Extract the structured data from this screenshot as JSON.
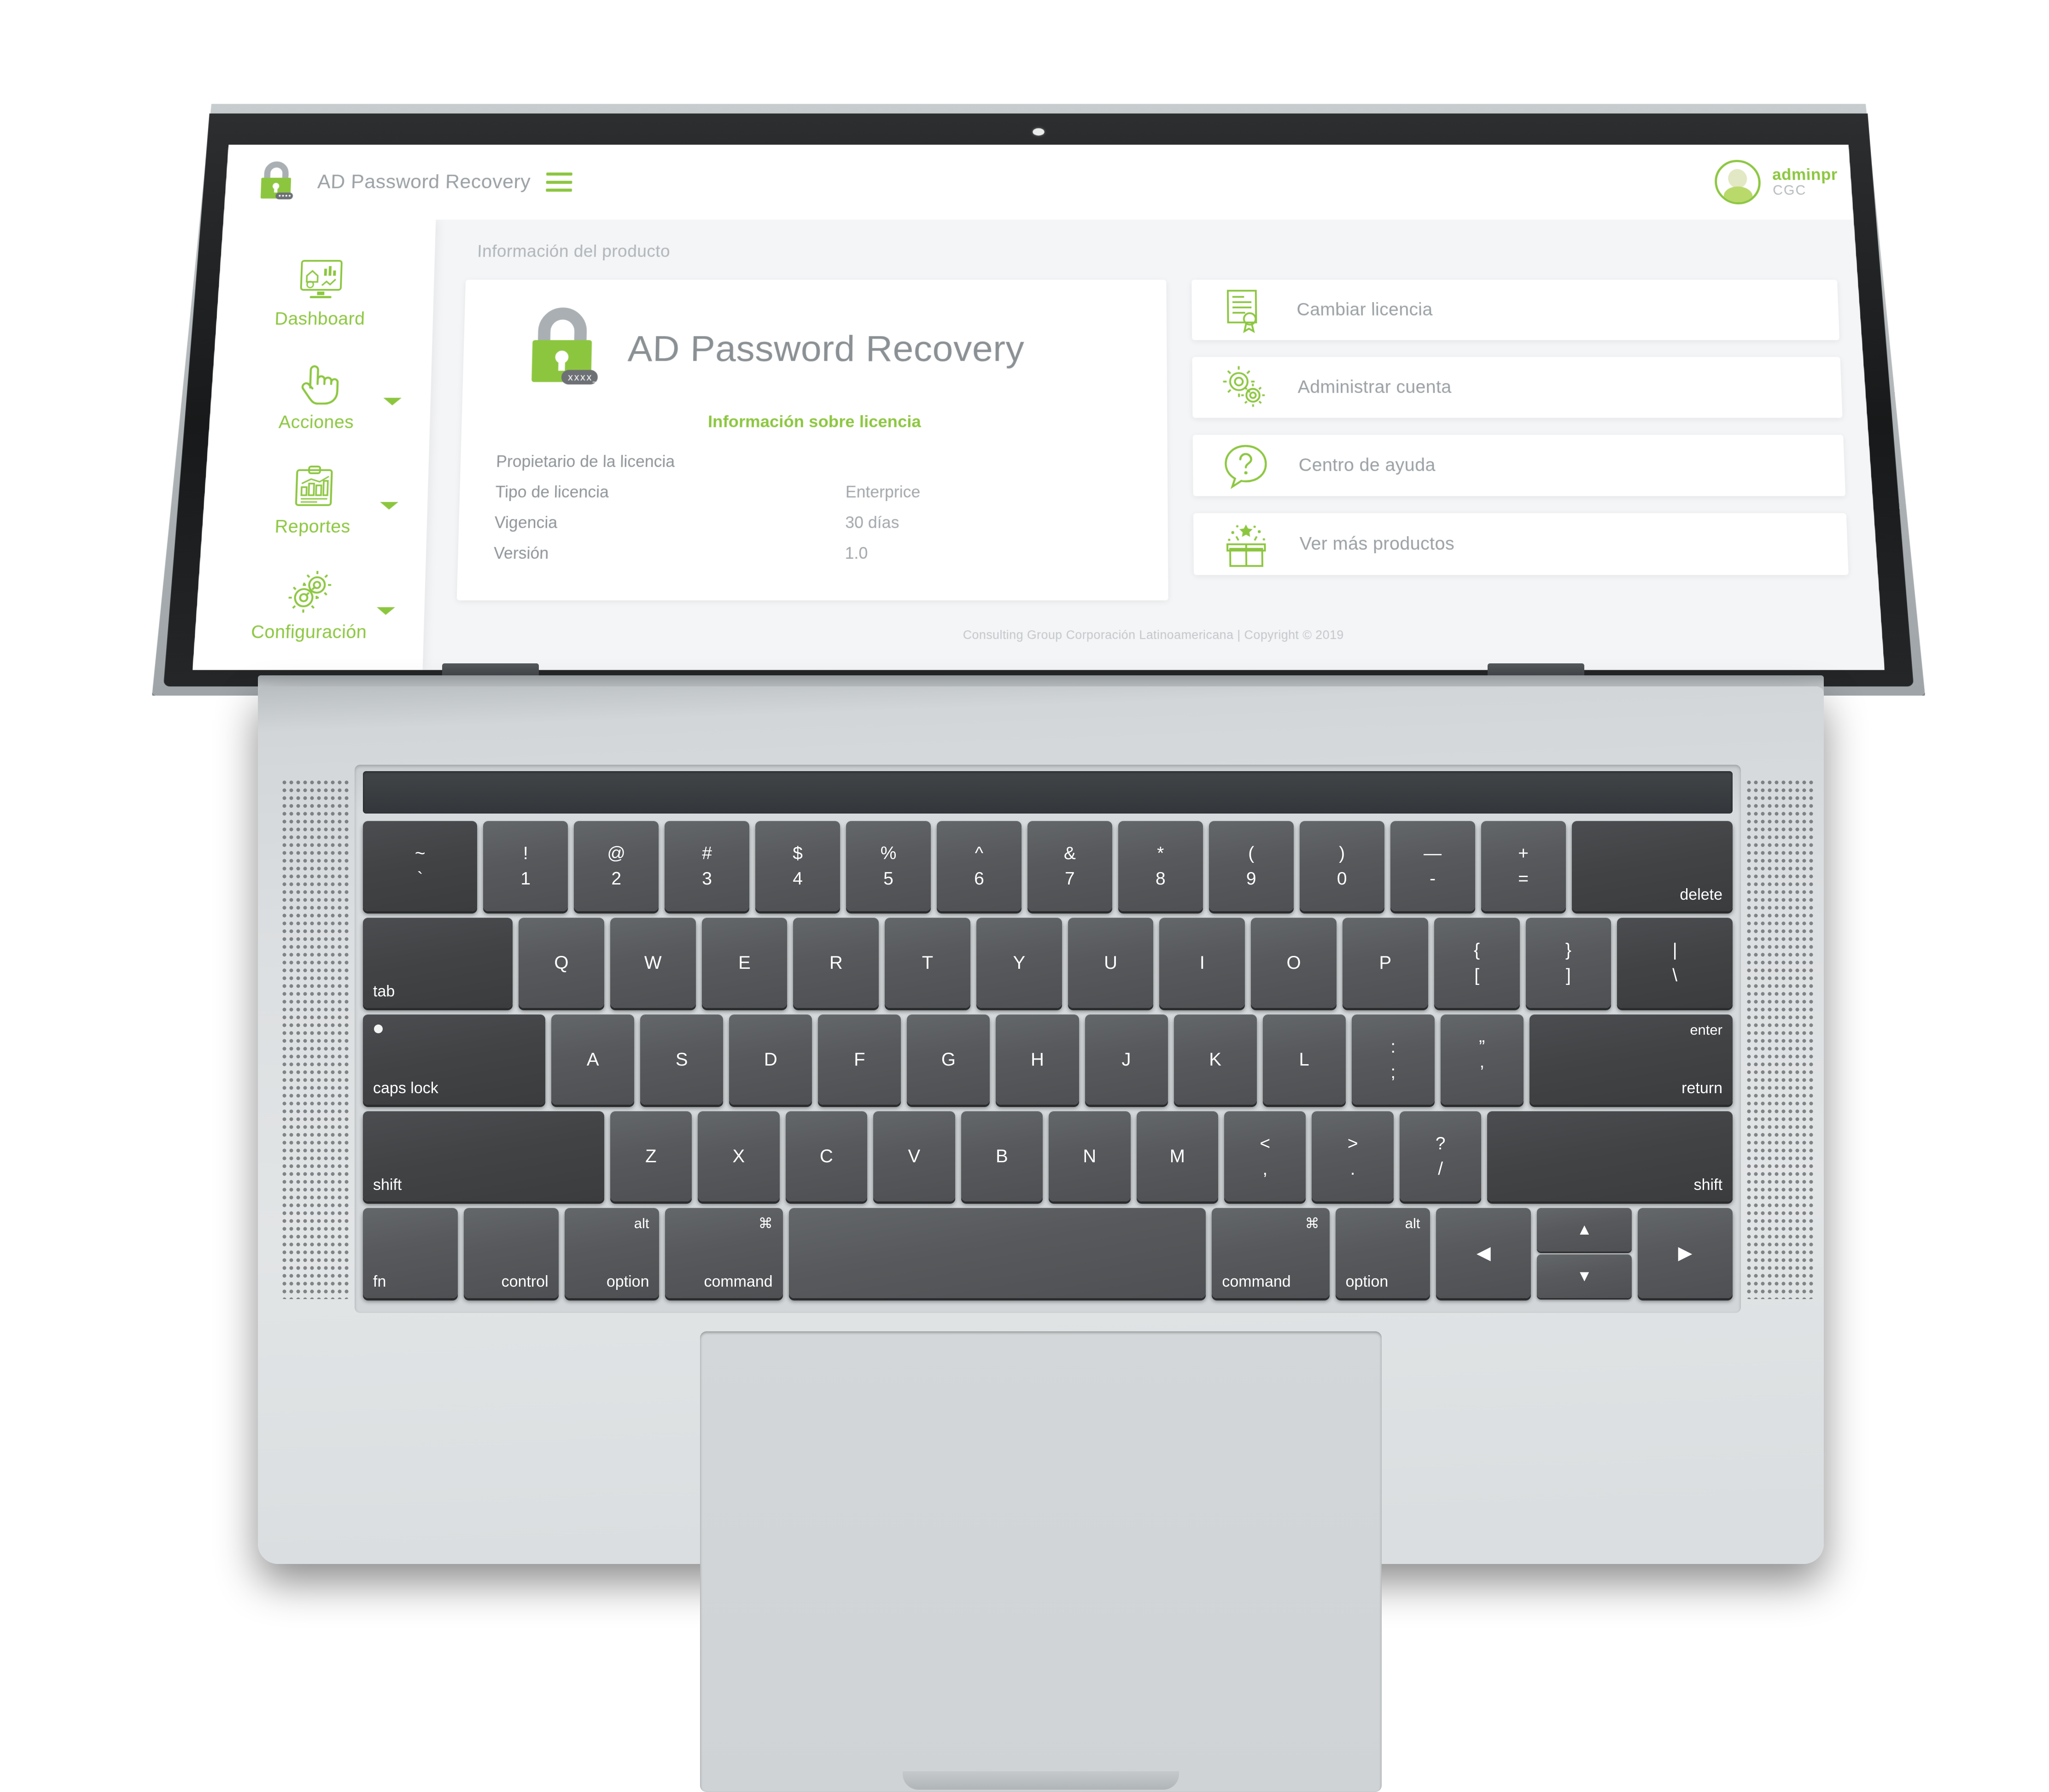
{
  "app": {
    "title": "AD Password Recovery",
    "logo_icon": "padlock-icon",
    "menu_icon": "hamburger-menu-icon"
  },
  "user": {
    "name": "adminpr",
    "org": "CGC",
    "avatar_icon": "user-avatar-icon"
  },
  "sidebar": {
    "items": [
      {
        "label": "Dashboard",
        "icon": "dashboard-monitor-icon",
        "has_caret": false
      },
      {
        "label": "Acciones",
        "icon": "hand-pointer-icon",
        "has_caret": true
      },
      {
        "label": "Reportes",
        "icon": "clipboard-chart-icon",
        "has_caret": true
      },
      {
        "label": "Configuración",
        "icon": "gears-icon",
        "has_caret": true
      }
    ]
  },
  "main": {
    "page_title": "Información del producto",
    "product": {
      "name": "AD Password Recovery",
      "logo_icon": "padlock-password-icon",
      "license_section_title": "Información sobre licencia",
      "license_rows": [
        {
          "key": "Propietario de la licencia",
          "value": ""
        },
        {
          "key": "Tipo de licencia",
          "value": "Enterprice"
        },
        {
          "key": "Vigencia",
          "value": "30 días"
        },
        {
          "key": "Versión",
          "value": "1.0"
        }
      ]
    },
    "actions": [
      {
        "label": "Cambiar licencia",
        "icon": "certificate-icon"
      },
      {
        "label": "Administrar cuenta",
        "icon": "gears-icon"
      },
      {
        "label": "Centro de ayuda",
        "icon": "question-bubble-icon"
      },
      {
        "label": "Ver más productos",
        "icon": "gift-box-icon"
      }
    ]
  },
  "footer": {
    "text": "Consulting Group Corporación Latinoamericana | Copyright © 2019"
  },
  "colors": {
    "accent_green": "#8cc63f",
    "text_gray": "#9aa0a4",
    "page_bg": "#f4f5f7"
  },
  "keyboard": {
    "rows": [
      {
        "keys": [
          {
            "up": "~",
            "lo": "`",
            "dark": true,
            "flex": 1.35
          },
          {
            "up": "!",
            "lo": "1"
          },
          {
            "up": "@",
            "lo": "2"
          },
          {
            "up": "#",
            "lo": "3"
          },
          {
            "up": "$",
            "lo": "4"
          },
          {
            "up": "%",
            "lo": "5"
          },
          {
            "up": "^",
            "lo": "6"
          },
          {
            "up": "&",
            "lo": "7"
          },
          {
            "up": "*",
            "lo": "8"
          },
          {
            "up": "(",
            "lo": "9"
          },
          {
            "up": ")",
            "lo": "0"
          },
          {
            "up": "—",
            "lo": "-"
          },
          {
            "up": "+",
            "lo": "="
          },
          {
            "br": "delete",
            "dark": true,
            "flex": 1.9
          }
        ]
      },
      {
        "keys": [
          {
            "bl": "tab",
            "dark": true,
            "flex": 1.75
          },
          {
            "ctr": "Q"
          },
          {
            "ctr": "W"
          },
          {
            "ctr": "E"
          },
          {
            "ctr": "R"
          },
          {
            "ctr": "T"
          },
          {
            "ctr": "Y"
          },
          {
            "ctr": "U"
          },
          {
            "ctr": "I"
          },
          {
            "ctr": "O"
          },
          {
            "ctr": "P"
          },
          {
            "up": "{",
            "lo": "["
          },
          {
            "up": "}",
            "lo": "]"
          },
          {
            "up": "|",
            "lo": "\\",
            "dark": true,
            "flex": 1.35
          }
        ]
      },
      {
        "keys": [
          {
            "bl": "caps lock",
            "capsdot": true,
            "dark": true,
            "flex": 2.2
          },
          {
            "ctr": "A"
          },
          {
            "ctr": "S"
          },
          {
            "ctr": "D"
          },
          {
            "ctr": "F"
          },
          {
            "ctr": "G"
          },
          {
            "ctr": "H"
          },
          {
            "ctr": "J"
          },
          {
            "ctr": "K"
          },
          {
            "ctr": "L"
          },
          {
            "up": ":",
            "lo": ";"
          },
          {
            "up": "”",
            "lo": "’"
          },
          {
            "tr": "enter",
            "br": "return",
            "dark": true,
            "flex": 2.45
          }
        ]
      },
      {
        "keys": [
          {
            "bl": "shift",
            "dark": true,
            "flex": 2.95
          },
          {
            "ctr": "Z"
          },
          {
            "ctr": "X"
          },
          {
            "ctr": "C"
          },
          {
            "ctr": "V"
          },
          {
            "ctr": "B"
          },
          {
            "ctr": "N"
          },
          {
            "ctr": "M"
          },
          {
            "up": "<",
            "lo": ","
          },
          {
            "up": ">",
            "lo": "."
          },
          {
            "up": "?",
            "lo": "/"
          },
          {
            "br": "shift",
            "dark": true,
            "flex": 3.0
          }
        ]
      },
      {
        "keys": [
          {
            "bl": "fn",
            "flex": 1.25
          },
          {
            "br": "control",
            "flex": 1.25
          },
          {
            "tr": "alt",
            "br": "option",
            "flex": 1.25
          },
          {
            "tr": "⌘",
            "br": "command",
            "flex": 1.55
          },
          {
            "flex": 5.5
          },
          {
            "tr": "⌘",
            "bl": "command",
            "flex": 1.55
          },
          {
            "tr": "alt",
            "bl": "option",
            "flex": 1.25
          },
          {
            "ctr": "◀",
            "flex": 1.25
          },
          {
            "arrows": [
              "▲",
              "▼"
            ],
            "flex": 1.25
          },
          {
            "ctr": "▶",
            "flex": 1.25
          }
        ]
      }
    ]
  }
}
